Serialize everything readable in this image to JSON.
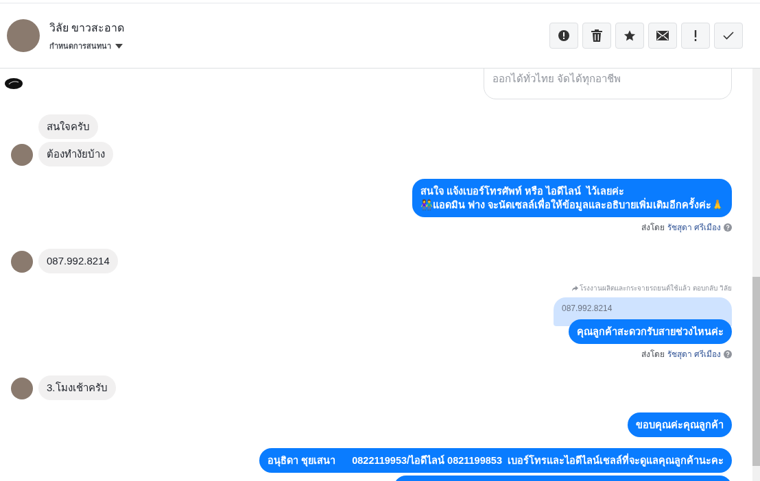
{
  "header": {
    "contact_name": "วิลัย ขาวสะอาด",
    "conversation_menu": "กำหนดการสนทนา",
    "actions": [
      {
        "kind": "spam"
      },
      {
        "kind": "delete"
      },
      {
        "kind": "star"
      },
      {
        "kind": "unread"
      },
      {
        "kind": "important"
      },
      {
        "kind": "done"
      }
    ]
  },
  "messages": [
    {
      "kind": "card",
      "text": "ออกได้ทั่วไทย จัดได้ทุกอาชีพ"
    },
    {
      "kind": "incoming",
      "bubbles": [
        "สนใจครับ",
        "ต้องทำงัยบ้าง"
      ]
    },
    {
      "kind": "outgoing",
      "bubbles": [
        "สนใจ แจ้งเบอร์โทรศัพท์ หรือ ไอดีไลน์  ไว้เลยค่ะ\n👫แอดมิน ฟาง จะนัดเซลล์เพื่อให้ข้อมูลและอธิบายเพิ่มเติมอีกครั้งค่ะ🙏"
      ],
      "sent_by": "ส่งโดย",
      "sender": "รัชสุดา ศรีเมือง"
    },
    {
      "kind": "incoming",
      "bubbles": [
        "087.992.8214"
      ]
    },
    {
      "kind": "reply",
      "reply_note": "โรงงานผลิตและกระจายรถยนต์ใช้แล้ว ตอบกลับ วิลัย",
      "quoted": "087.992.8214",
      "bubbles": [
        "คุณลูกค้าสะดวกรับสายช่วงไหนค่ะ"
      ],
      "sent_by": "ส่งโดย",
      "sender": "รัชสุดา ศรีเมือง"
    },
    {
      "kind": "incoming",
      "bubbles": [
        "3.โมงเช้าครับ"
      ]
    },
    {
      "kind": "outgoing",
      "bubbles": [
        "ขอบคุณค่ะคุณลูกค้า",
        "อนุธิดา ชุยเสนา      0822119953/ไอดีไลน์ 0821199853  เบอร์โทรและไอดีไลน์เชลล์ที่จะดูแลคุณลูกค้านะคะ"
      ]
    },
    {
      "kind": "cutoff"
    }
  ]
}
